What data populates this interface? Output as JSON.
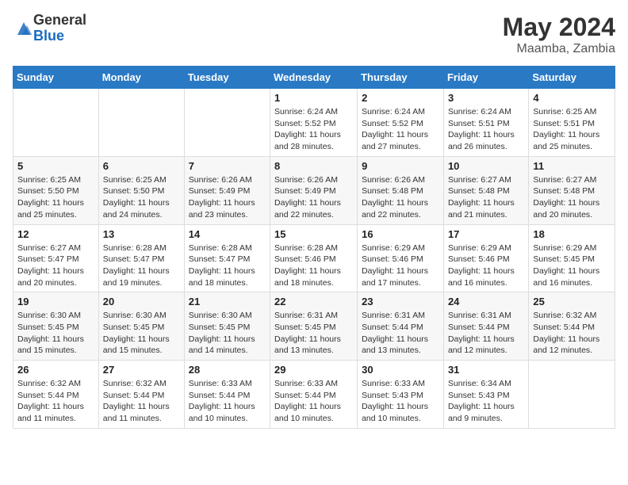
{
  "logo": {
    "general": "General",
    "blue": "Blue"
  },
  "title": {
    "month_year": "May 2024",
    "location": "Maamba, Zambia"
  },
  "weekdays": [
    "Sunday",
    "Monday",
    "Tuesday",
    "Wednesday",
    "Thursday",
    "Friday",
    "Saturday"
  ],
  "weeks": [
    [
      {
        "day": "",
        "info": ""
      },
      {
        "day": "",
        "info": ""
      },
      {
        "day": "",
        "info": ""
      },
      {
        "day": "1",
        "info": "Sunrise: 6:24 AM\nSunset: 5:52 PM\nDaylight: 11 hours and 28 minutes."
      },
      {
        "day": "2",
        "info": "Sunrise: 6:24 AM\nSunset: 5:52 PM\nDaylight: 11 hours and 27 minutes."
      },
      {
        "day": "3",
        "info": "Sunrise: 6:24 AM\nSunset: 5:51 PM\nDaylight: 11 hours and 26 minutes."
      },
      {
        "day": "4",
        "info": "Sunrise: 6:25 AM\nSunset: 5:51 PM\nDaylight: 11 hours and 25 minutes."
      }
    ],
    [
      {
        "day": "5",
        "info": "Sunrise: 6:25 AM\nSunset: 5:50 PM\nDaylight: 11 hours and 25 minutes."
      },
      {
        "day": "6",
        "info": "Sunrise: 6:25 AM\nSunset: 5:50 PM\nDaylight: 11 hours and 24 minutes."
      },
      {
        "day": "7",
        "info": "Sunrise: 6:26 AM\nSunset: 5:49 PM\nDaylight: 11 hours and 23 minutes."
      },
      {
        "day": "8",
        "info": "Sunrise: 6:26 AM\nSunset: 5:49 PM\nDaylight: 11 hours and 22 minutes."
      },
      {
        "day": "9",
        "info": "Sunrise: 6:26 AM\nSunset: 5:48 PM\nDaylight: 11 hours and 22 minutes."
      },
      {
        "day": "10",
        "info": "Sunrise: 6:27 AM\nSunset: 5:48 PM\nDaylight: 11 hours and 21 minutes."
      },
      {
        "day": "11",
        "info": "Sunrise: 6:27 AM\nSunset: 5:48 PM\nDaylight: 11 hours and 20 minutes."
      }
    ],
    [
      {
        "day": "12",
        "info": "Sunrise: 6:27 AM\nSunset: 5:47 PM\nDaylight: 11 hours and 20 minutes."
      },
      {
        "day": "13",
        "info": "Sunrise: 6:28 AM\nSunset: 5:47 PM\nDaylight: 11 hours and 19 minutes."
      },
      {
        "day": "14",
        "info": "Sunrise: 6:28 AM\nSunset: 5:47 PM\nDaylight: 11 hours and 18 minutes."
      },
      {
        "day": "15",
        "info": "Sunrise: 6:28 AM\nSunset: 5:46 PM\nDaylight: 11 hours and 18 minutes."
      },
      {
        "day": "16",
        "info": "Sunrise: 6:29 AM\nSunset: 5:46 PM\nDaylight: 11 hours and 17 minutes."
      },
      {
        "day": "17",
        "info": "Sunrise: 6:29 AM\nSunset: 5:46 PM\nDaylight: 11 hours and 16 minutes."
      },
      {
        "day": "18",
        "info": "Sunrise: 6:29 AM\nSunset: 5:45 PM\nDaylight: 11 hours and 16 minutes."
      }
    ],
    [
      {
        "day": "19",
        "info": "Sunrise: 6:30 AM\nSunset: 5:45 PM\nDaylight: 11 hours and 15 minutes."
      },
      {
        "day": "20",
        "info": "Sunrise: 6:30 AM\nSunset: 5:45 PM\nDaylight: 11 hours and 15 minutes."
      },
      {
        "day": "21",
        "info": "Sunrise: 6:30 AM\nSunset: 5:45 PM\nDaylight: 11 hours and 14 minutes."
      },
      {
        "day": "22",
        "info": "Sunrise: 6:31 AM\nSunset: 5:45 PM\nDaylight: 11 hours and 13 minutes."
      },
      {
        "day": "23",
        "info": "Sunrise: 6:31 AM\nSunset: 5:44 PM\nDaylight: 11 hours and 13 minutes."
      },
      {
        "day": "24",
        "info": "Sunrise: 6:31 AM\nSunset: 5:44 PM\nDaylight: 11 hours and 12 minutes."
      },
      {
        "day": "25",
        "info": "Sunrise: 6:32 AM\nSunset: 5:44 PM\nDaylight: 11 hours and 12 minutes."
      }
    ],
    [
      {
        "day": "26",
        "info": "Sunrise: 6:32 AM\nSunset: 5:44 PM\nDaylight: 11 hours and 11 minutes."
      },
      {
        "day": "27",
        "info": "Sunrise: 6:32 AM\nSunset: 5:44 PM\nDaylight: 11 hours and 11 minutes."
      },
      {
        "day": "28",
        "info": "Sunrise: 6:33 AM\nSunset: 5:44 PM\nDaylight: 11 hours and 10 minutes."
      },
      {
        "day": "29",
        "info": "Sunrise: 6:33 AM\nSunset: 5:44 PM\nDaylight: 11 hours and 10 minutes."
      },
      {
        "day": "30",
        "info": "Sunrise: 6:33 AM\nSunset: 5:43 PM\nDaylight: 11 hours and 10 minutes."
      },
      {
        "day": "31",
        "info": "Sunrise: 6:34 AM\nSunset: 5:43 PM\nDaylight: 11 hours and 9 minutes."
      },
      {
        "day": "",
        "info": ""
      }
    ]
  ]
}
